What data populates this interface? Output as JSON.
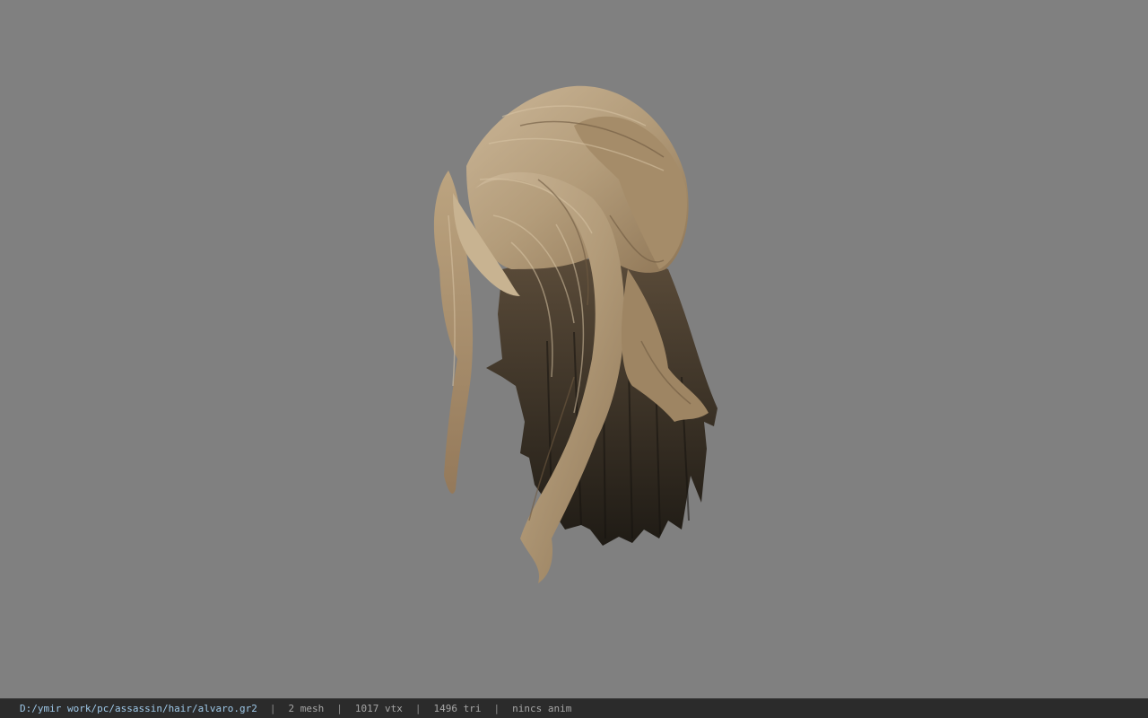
{
  "status_bar": {
    "file_path": "D:/ymir work/pc/assassin/hair/alvaro.gr2",
    "separator": "|",
    "mesh": "2 mesh",
    "vertices": "1017 vtx",
    "triangles": "1496 tri",
    "animation": "nincs anim"
  },
  "colors": {
    "viewport_background": "#808080",
    "status_bar_background": "#2b2b2b",
    "path_text": "#9ec8e8",
    "hair_light": "#c2ad8c",
    "hair_mid": "#a38b6a",
    "hair_dark": "#2e2820"
  }
}
